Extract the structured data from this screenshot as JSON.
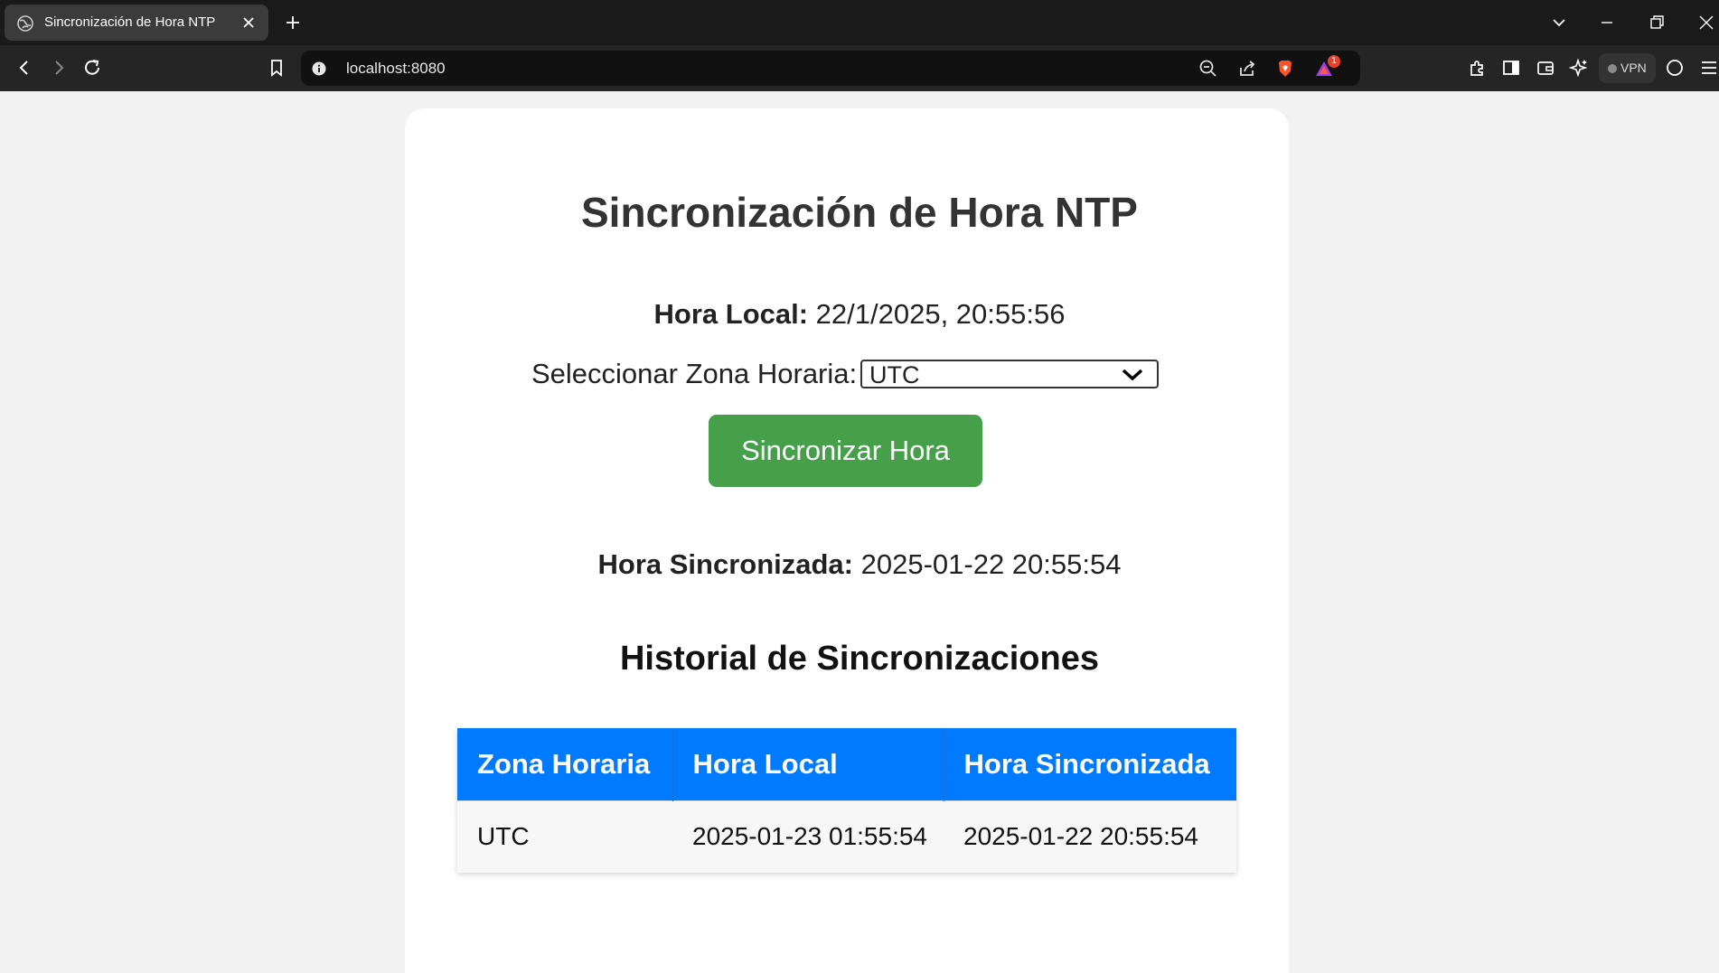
{
  "browser": {
    "tab_title": "Sincronización de Hora NTP",
    "url": "localhost:8080",
    "vpn_label": "VPN",
    "shield_badge": "1"
  },
  "page": {
    "title": "Sincronización de Hora NTP",
    "local_time_label": "Hora Local:",
    "local_time_value": "22/1/2025, 20:55:56",
    "timezone_label": "Seleccionar Zona Horaria:",
    "timezone_selected": "UTC",
    "sync_button": "Sincronizar Hora",
    "synced_label": "Hora Sincronizada:",
    "synced_value": "2025-01-22 20:55:54",
    "history_title": "Historial de Sincronizaciones",
    "table": {
      "headers": [
        "Zona Horaria",
        "Hora Local",
        "Hora Sincronizada"
      ],
      "rows": [
        [
          "UTC",
          "2025-01-23 01:55:54",
          "2025-01-22 20:55:54"
        ]
      ]
    }
  },
  "colors": {
    "accent_button": "#46a049",
    "table_header": "#007bff"
  },
  "icons": [
    "globe-icon",
    "close-icon",
    "plus-icon",
    "chevron-down-icon",
    "minimize-icon",
    "restore-icon",
    "back-icon",
    "forward-icon",
    "reload-icon",
    "bookmark-icon",
    "info-icon",
    "zoom-icon",
    "share-icon",
    "brave-shield-icon",
    "brave-rewards-icon",
    "extensions-icon",
    "sidebar-icon",
    "wallet-icon",
    "leo-ai-icon",
    "theme-icon",
    "menu-icon"
  ]
}
